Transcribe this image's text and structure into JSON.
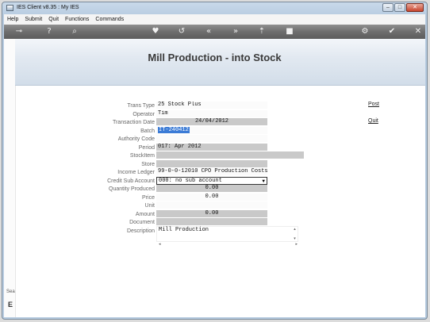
{
  "window": {
    "title": "IES Client v8.35 : My IES",
    "controls": {
      "minimize": "–",
      "maximize": "□",
      "close": "✕"
    }
  },
  "menu": {
    "items": [
      "Help",
      "Submit",
      "Quit",
      "Functions",
      "Commands"
    ]
  },
  "toolbar": {
    "icons": [
      "key-icon",
      "help-icon",
      "search-icon",
      "heart-icon",
      "undo-icon",
      "rewind-icon",
      "fast-forward-icon",
      "upload-icon",
      "stop-icon",
      "gear-icon",
      "check-icon",
      "close-icon"
    ],
    "glyphs": [
      "⊸",
      "?",
      "⌕",
      "♥",
      "↺",
      "«",
      "»",
      "⇡",
      "■",
      "⚙",
      "✔",
      "✕"
    ]
  },
  "page": {
    "title": "Mill Production - into Stock"
  },
  "sidebar": {
    "text1": "Sea",
    "text2": "E"
  },
  "form": {
    "labels": {
      "trans_type": "Trans Type",
      "operator": "Operator",
      "transaction_date": "Transaction Date",
      "batch": "Batch",
      "authority_code": "Authority Code",
      "period": "Period",
      "stock_item": "StockItem",
      "store": "Store",
      "income_ledger": "Income Ledger",
      "credit_sub_account": "Credit Sub Account",
      "quantity_produced": "Quantity Produced",
      "price": "Price",
      "unit": "Unit",
      "amount": "Amount",
      "document": "Document",
      "description": "Description"
    },
    "values": {
      "trans_type": "25 Stock Plus",
      "operator": "Tim",
      "transaction_date": "24/04/2012",
      "batch": "IT-240412",
      "authority_code": "",
      "period": "017: Apr 2012",
      "stock_item": "",
      "store": "",
      "income_ledger": "99-0-0-12010 CPO Production Costs",
      "credit_sub_account": "000: no sub account",
      "quantity_produced": "0.00",
      "price": "0.00",
      "unit": "",
      "amount": "0.00",
      "document": "",
      "description": "Mill Production"
    }
  },
  "actions": {
    "post": "Post",
    "quit": "Quit"
  }
}
